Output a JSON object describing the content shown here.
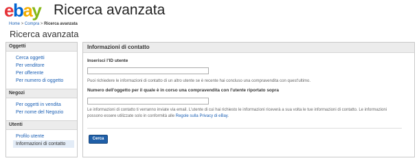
{
  "header": {
    "logo_letters": [
      "e",
      "b",
      "a",
      "y"
    ],
    "logo_colors": [
      "#e53238",
      "#0064d2",
      "#f5af02",
      "#86b817"
    ],
    "app_title": "Ricerca avanzata"
  },
  "breadcrumb": {
    "home": "Home",
    "sep1": ">",
    "buy": "Compra",
    "sep2": ">",
    "current": "Ricerca avanzata"
  },
  "page_title": "Ricerca avanzata",
  "sidebar": {
    "sections": [
      {
        "title": "Oggetti",
        "items": [
          "Cerca oggetti",
          "Per venditore",
          "Per offerente",
          "Per numero di oggetto"
        ]
      },
      {
        "title": "Negozi",
        "items": [
          "Per oggetti in vendita",
          "Per nome del Negozio"
        ]
      },
      {
        "title": "Utenti",
        "items": [
          "Profilo utente",
          "Informazioni di contatto"
        ]
      }
    ]
  },
  "main": {
    "title": "Informazioni di contatto",
    "field1_label": "Inserisci l'ID utente",
    "field1_value": "",
    "field1_hint": "Puoi richiedere le informazioni di contatto di un altro utente se è recente hai concluso una compravendita con quest'ultimo.",
    "field2_label": "Numero dell'oggetto per il quale è in corso una compravendita con l'utente riportato sopra",
    "field2_value": "",
    "info_text": "Le informazioni di contatto ti verranno inviate via email. L'utente di cui hai richiesto le informazioni riceverà a sua volta le tue informazioni di contatto. Le informazioni possono essere utilizzate solo in conformità alle",
    "info_link": "Regole sulla Privacy di eBay",
    "info_end": ".",
    "search_button": "Cerca"
  }
}
